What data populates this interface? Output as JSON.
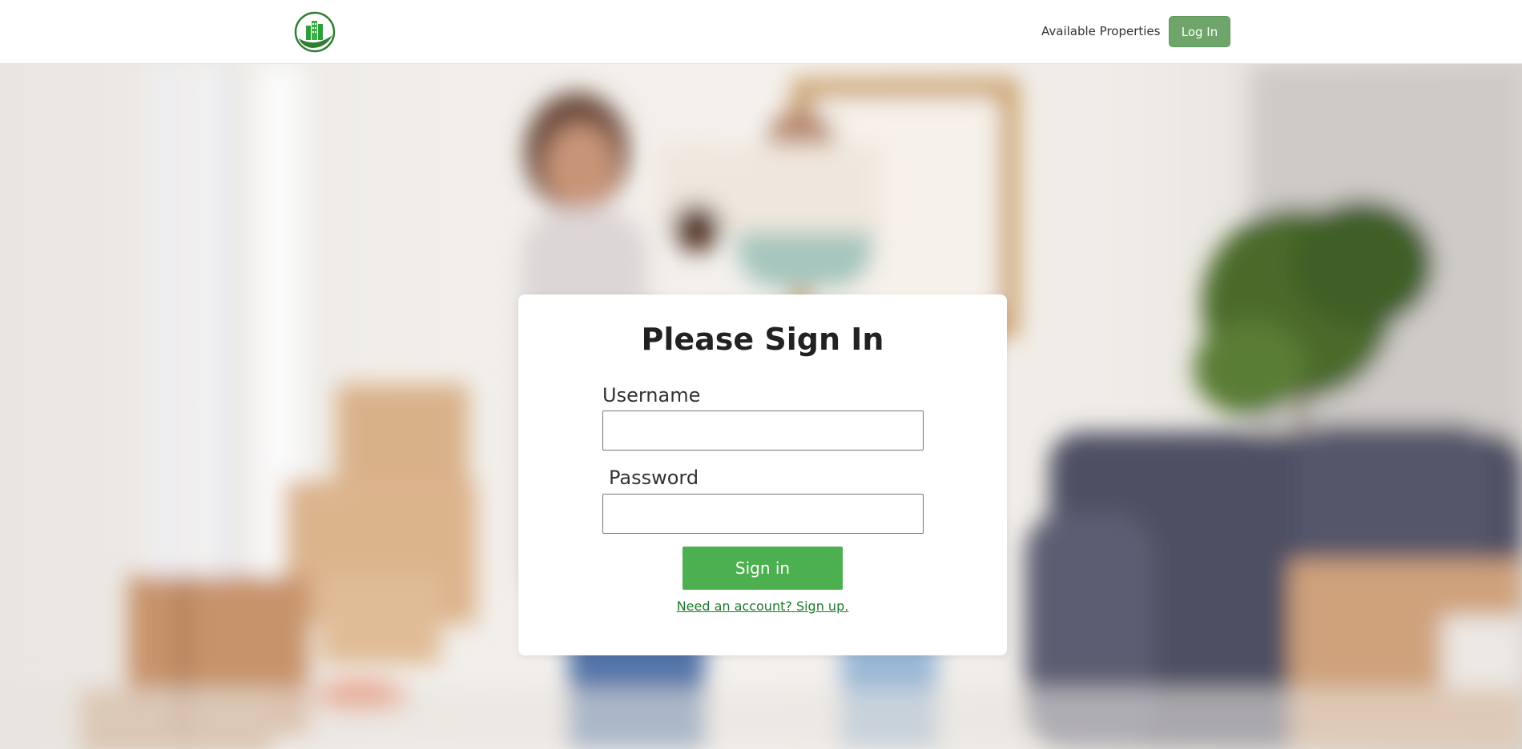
{
  "navbar": {
    "logo_icon": "green-buildings-leaf-logo",
    "available_properties": "Available Properties",
    "login_label": "Log In"
  },
  "hero": {
    "background_image": "blurred-family-moving-boxes-living-room"
  },
  "signin_card": {
    "title": "Please Sign In",
    "username_label": "Username",
    "username_value": "",
    "password_label": "Password",
    "password_value": "",
    "submit_label": "Sign in",
    "signup_link": "Need an account? Sign up."
  },
  "colors": {
    "brand_green": "#4caf50",
    "nav_button_green": "#6fa56b",
    "link_green": "#1a7a2a"
  }
}
